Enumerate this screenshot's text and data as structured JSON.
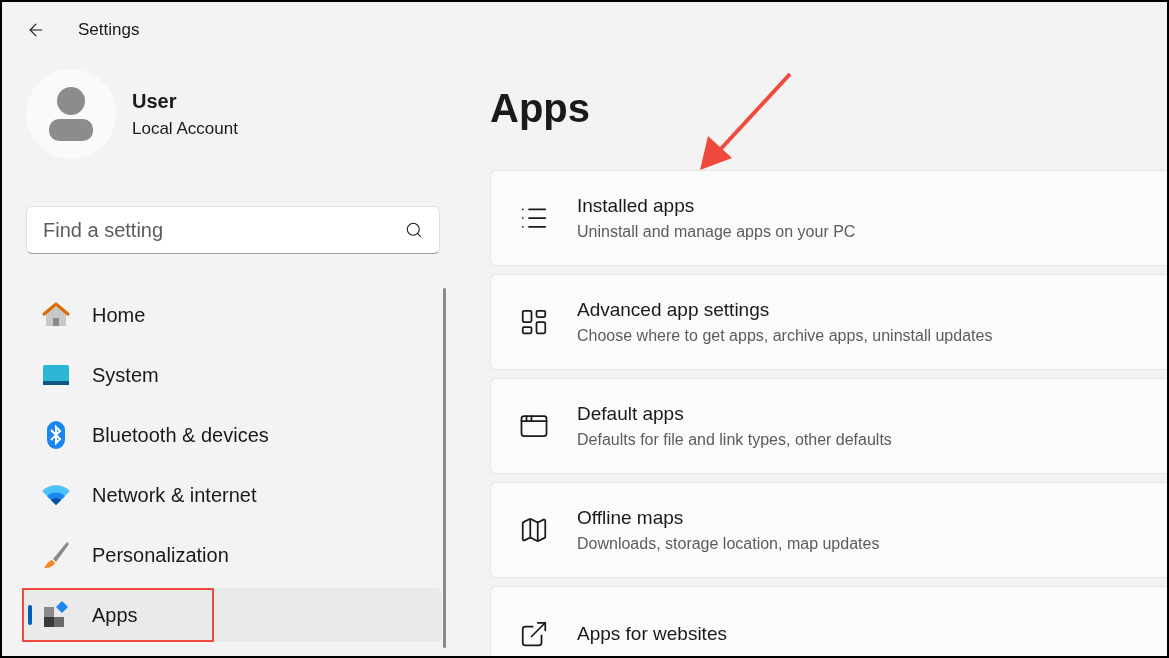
{
  "window": {
    "title": "Settings"
  },
  "account": {
    "name": "User",
    "type": "Local Account"
  },
  "search": {
    "placeholder": "Find a setting"
  },
  "nav": [
    {
      "label": "Home",
      "selected": false,
      "highlighted": false
    },
    {
      "label": "System",
      "selected": false,
      "highlighted": false
    },
    {
      "label": "Bluetooth & devices",
      "selected": false,
      "highlighted": false
    },
    {
      "label": "Network & internet",
      "selected": false,
      "highlighted": false
    },
    {
      "label": "Personalization",
      "selected": false,
      "highlighted": false
    },
    {
      "label": "Apps",
      "selected": true,
      "highlighted": true
    }
  ],
  "page": {
    "title": "Apps"
  },
  "cards": [
    {
      "title": "Installed apps",
      "subtitle": "Uninstall and manage apps on your PC"
    },
    {
      "title": "Advanced app settings",
      "subtitle": "Choose where to get apps, archive apps, uninstall updates"
    },
    {
      "title": "Default apps",
      "subtitle": "Defaults for file and link types, other defaults"
    },
    {
      "title": "Offline maps",
      "subtitle": "Downloads, storage location, map updates"
    },
    {
      "title": "Apps for websites"
    }
  ]
}
